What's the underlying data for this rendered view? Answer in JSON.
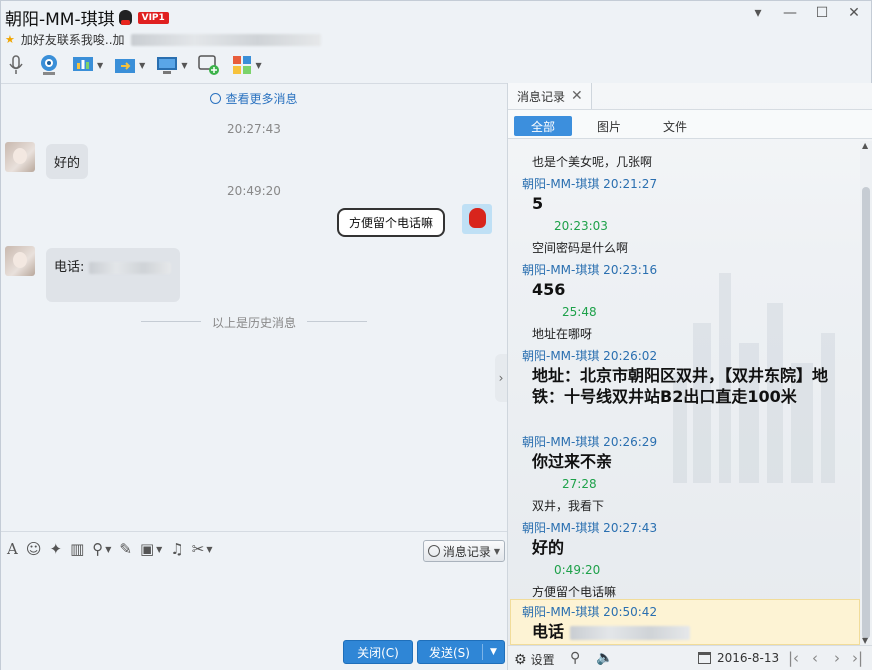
{
  "window": {
    "title": "朝阳-MM-琪琪",
    "vip_badge": "VIP1",
    "signature": "加好友联系我唆..加"
  },
  "chat": {
    "more_messages": "查看更多消息",
    "time1": "20:27:43",
    "msg1": "好的",
    "time2": "20:49:20",
    "msg2": "方便留个电话嘛",
    "msg3": "电话:",
    "history_divider": "以上是历史消息"
  },
  "input_bar": {
    "history_button": "消息记录",
    "close_button": "关闭(C)",
    "send_button": "发送(S)"
  },
  "history_panel": {
    "tab_label": "消息记录",
    "filters": [
      "全部",
      "图片",
      "文件"
    ],
    "messages": [
      {
        "header": "",
        "text": "也是个美女呢，几张啊",
        "big": false
      },
      {
        "header": "朝阳-MM-琪琪 20:21:27",
        "text": "5",
        "big": true
      },
      {
        "header": "20:23:03",
        "text": "空间密码是什么啊",
        "big": false
      },
      {
        "header": "朝阳-MM-琪琪 20:23:16",
        "text": "456",
        "big": true
      },
      {
        "header": "25:48",
        "text": "地址在哪呀",
        "big": false
      },
      {
        "header": "朝阳-MM-琪琪 20:26:02",
        "text": "地址：北京市朝阳区双井，【双井东院】地铁：十号线双井站B2出口直走100米",
        "big": true
      },
      {
        "header": "朝阳-MM-琪琪 20:26:29",
        "text": "你过来不亲",
        "big": true
      },
      {
        "header": "27:28",
        "text": "双井，我看下",
        "big": false
      },
      {
        "header": "朝阳-MM-琪琪 20:27:43",
        "text": "好的",
        "big": true
      },
      {
        "header": "0:49:20",
        "text": "方便留个电话嘛",
        "big": false
      },
      {
        "header": "朝阳-MM-琪琪 20:50:42",
        "text": "电话",
        "big": true
      }
    ],
    "footer_settings": "设置",
    "footer_date": "2016-8-13"
  },
  "colors": {
    "accent": "#2f86d6",
    "peer_name": "#2a6fb0",
    "self_time": "#1ea14a",
    "highlight": "#fdf3d4"
  }
}
